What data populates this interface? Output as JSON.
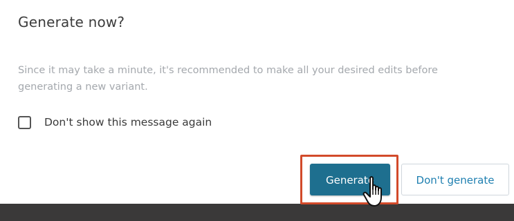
{
  "dialog": {
    "title": "Generate now?",
    "message": "Since it may take a minute, it's recommended to make all your desired edits before generating a new variant.",
    "checkbox": {
      "label": "Don't show this message again",
      "checked": false
    },
    "buttons": {
      "generate_label": "Generate",
      "dont_generate_label": "Don't generate"
    }
  },
  "colors": {
    "primary": "#1e6f8f",
    "link": "#1e7fb0",
    "highlight": "#d24a2a",
    "muted_text": "#a4a8ad"
  },
  "icons": {
    "cursor": "hand-pointer-icon"
  }
}
